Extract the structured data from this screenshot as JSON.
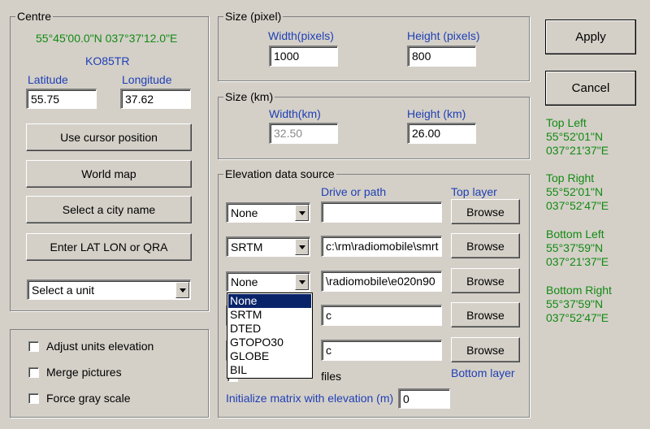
{
  "centre": {
    "legend": "Centre",
    "coords": "55°45'00.0\"N 037°37'12.0\"E",
    "qra": "KO85TR",
    "latitude_label": "Latitude",
    "longitude_label": "Longitude",
    "latitude_value": "55.75",
    "longitude_value": "37.62",
    "use_cursor_label": "Use cursor position",
    "world_map_label": "World map",
    "select_city_label": "Select a city name",
    "enter_latlon_label": "Enter LAT LON or QRA",
    "unit_select_value": "Select a unit"
  },
  "options": {
    "adjust_label": "Adjust units elevation",
    "merge_label": "Merge pictures",
    "gray_label": "Force gray scale",
    "adjust_checked": false,
    "merge_checked": false,
    "gray_checked": false
  },
  "size_pixel": {
    "legend": "Size (pixel)",
    "width_label": "Width(pixels)",
    "height_label": "Height (pixels)",
    "width_value": "1000",
    "height_value": "800"
  },
  "size_km": {
    "legend": "Size (km)",
    "width_label": "Width(km)",
    "height_label": "Height (km)",
    "width_value": "32.50",
    "height_value": "26.00"
  },
  "elevation": {
    "legend": "Elevation data source",
    "drive_label": "Drive or path",
    "top_layer_label": "Top layer",
    "bottom_layer_label": "Bottom layer",
    "browse_label": "Browse",
    "rows": [
      {
        "source": "None",
        "path": ""
      },
      {
        "source": "SRTM",
        "path": "c:\\rm\\radiomobile\\smrt"
      },
      {
        "source": "None",
        "path": "\\radiomobile\\e020n90"
      },
      {
        "source": "",
        "path": "c"
      },
      {
        "source": "",
        "path": "c"
      }
    ],
    "ignore_label": "Ignore missing files",
    "ignore_visible": "files",
    "init_label": "Initialize matrix with elevation (m)",
    "init_value": "0",
    "dropdown_options": [
      "None",
      "SRTM",
      "DTED",
      "GTOPO30",
      "GLOBE",
      "BIL"
    ],
    "dropdown_selected": "None"
  },
  "actions": {
    "apply_label": "Apply",
    "cancel_label": "Cancel"
  },
  "corners": {
    "top_left_label": "Top Left",
    "top_left_lat": "55°52'01\"N",
    "top_left_lon": "037°21'37\"E",
    "top_right_label": "Top Right",
    "top_right_lat": "55°52'01\"N",
    "top_right_lon": "037°52'47\"E",
    "bottom_left_label": "Bottom Left",
    "bottom_left_lat": "55°37'59\"N",
    "bottom_left_lon": "037°21'37\"E",
    "bottom_right_label": "Bottom Right",
    "bottom_right_lat": "55°37'59\"N",
    "bottom_right_lon": "037°52'47\"E"
  },
  "colors": {
    "background": "#d4d0c8",
    "label_blue": "#1f3fb5",
    "coord_green": "#138a13",
    "selection": "#0a246a"
  }
}
